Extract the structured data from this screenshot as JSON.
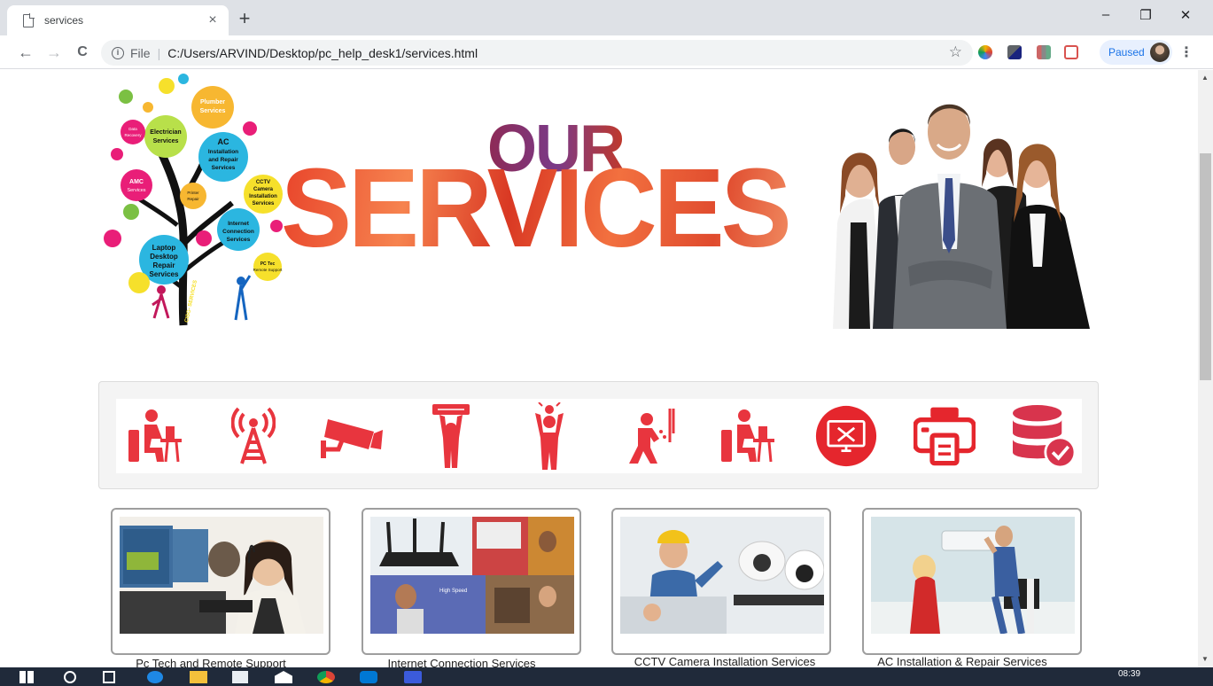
{
  "browser": {
    "tab_title": "services",
    "tab_close": "×",
    "new_tab": "+",
    "window_controls": {
      "minimize": "–",
      "restore": "❐",
      "close": "✕"
    },
    "nav": {
      "back": "←",
      "forward": "→",
      "reload": "C"
    },
    "omnibox": {
      "info_symbol": "i",
      "scheme_label": "File",
      "separator": "|",
      "url": "C:/Users/ARVIND/Desktop/pc_help_desk1/services.html"
    },
    "bookmark_star": "☆",
    "profile_status": "Paused",
    "menu": "⋮"
  },
  "banner": {
    "headline_top": "OUR",
    "headline_main": "SERVICES",
    "tree_services": [
      "Electrician Services",
      "Plumber Services",
      "AC Installation and Repair Services",
      "CCTV Camera Installation Services",
      "Internet Connection Services",
      "AMC Services",
      "Laptop Desktop Repair Services",
      "PC Tec Remote Support",
      "Data Recovery Services",
      "Printer Repair Services"
    ],
    "tree_trunk_text": "CISG- SERVICES"
  },
  "icon_strip": {
    "icons": [
      "desk-worker-icon",
      "antenna-tower-icon",
      "cctv-camera-icon",
      "ac-repair-icon",
      "electrician-icon",
      "plumber-icon",
      "desk-worker-icon",
      "monitor-tools-icon",
      "printer-icon",
      "database-check-icon"
    ],
    "accent_color": "#e8353e"
  },
  "cards": [
    {
      "label": "Pc Tech and Remote Support"
    },
    {
      "label": "Internet Connection Services"
    },
    {
      "label": "CCTV Camera Installation Services"
    },
    {
      "label": "AC Installation & Repair Services"
    }
  ],
  "taskbar": {
    "clock": "08:39"
  }
}
